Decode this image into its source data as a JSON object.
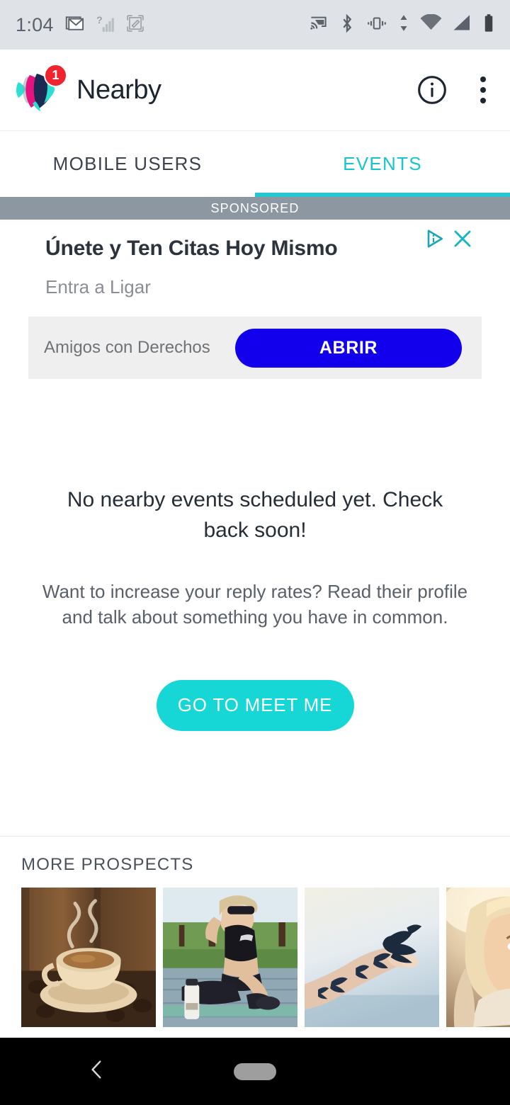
{
  "statusbar": {
    "time": "1:04",
    "left_icons": [
      "gmail-icon",
      "unknown-signal-icon",
      "screenshot-edit-icon"
    ],
    "right_icons": [
      "cast-icon",
      "bluetooth-icon",
      "vibrate-icon",
      "data-transfer-icon",
      "wifi-icon",
      "cellular-signal-icon",
      "battery-icon"
    ]
  },
  "appbar": {
    "title": "Nearby",
    "badge_count": "1",
    "logo_name": "meetme-fish-logo",
    "info_icon": "info-icon",
    "overflow_icon": "overflow-menu-icon",
    "logo_colors": {
      "teal": "#2bdfd2",
      "magenta": "#e6137f",
      "navy": "#1b2a52"
    }
  },
  "tabs": {
    "items": [
      {
        "label": "MOBILE USERS",
        "active": false
      },
      {
        "label": "EVENTS",
        "active": true
      }
    ],
    "active_color": "#17c6cd",
    "inactive_color": "#3c434d"
  },
  "ad": {
    "sponsored_label": "SPONSORED",
    "headline": "Únete y Ten Citas Hoy Mismo",
    "subtext": "Entra a Ligar",
    "advertiser": "Amigos con Derechos",
    "cta_label": "ABRIR",
    "cta_color": "#1200ec",
    "adchoices_icon": "adchoices-icon",
    "close_icon": "close-icon"
  },
  "empty_state": {
    "title": "No nearby events scheduled yet. Check back soon!",
    "subtitle": "Want to increase your reply rates? Read their profile and talk about something you have in common.",
    "cta_label": "GO TO MEET ME",
    "cta_color": "#17d6d6"
  },
  "prospects": {
    "heading": "MORE PROSPECTS",
    "thumbs": [
      {
        "name": "thumbnail-coffee-cup",
        "alt": "steaming coffee cup on saucer with coffee beans"
      },
      {
        "name": "thumbnail-fitness-woman",
        "alt": "woman in sportswear sitting on wooden deck"
      },
      {
        "name": "thumbnail-bird-tattoo",
        "alt": "arm with bird tattoos and hummingbird"
      },
      {
        "name": "thumbnail-smiling-blonde",
        "alt": "smiling blonde woman in sunlight"
      }
    ]
  },
  "navbar": {
    "back_icon": "back-chevron-icon",
    "home_icon": "home-pill-icon"
  }
}
